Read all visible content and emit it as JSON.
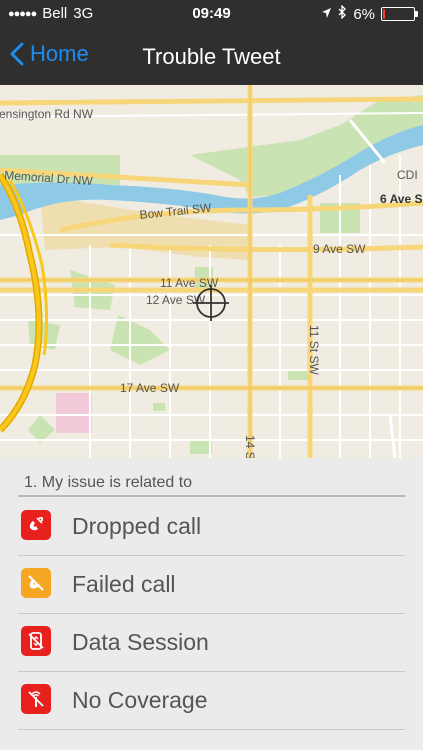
{
  "status_bar": {
    "signal": "●●●●●",
    "carrier": "Bell",
    "network": "3G",
    "time": "09:49",
    "battery_percent": "6%",
    "battery_level": 0.06
  },
  "nav": {
    "back_label": "Home",
    "title": "Trouble Tweet"
  },
  "map": {
    "labels": {
      "kensington": "ensington Rd NW",
      "memorial": "Memorial Dr NW",
      "bow_trail": "Bow Trail SW",
      "ave9": "9 Ave SW",
      "ave11": "11 Ave SW",
      "ave12": "12 Ave SW",
      "ave17": "17 Ave SW",
      "ave6": "6 Ave S",
      "st11": "11 St SW",
      "st14": "14 S",
      "cdi": "CDI"
    }
  },
  "form": {
    "section_title": "1. My issue is related to",
    "options": [
      {
        "label": "Dropped call",
        "icon": "dropped-call-icon",
        "color": "#e8201e"
      },
      {
        "label": "Failed call",
        "icon": "failed-call-icon",
        "color": "#f5a623"
      },
      {
        "label": "Data Session",
        "icon": "data-session-icon",
        "color": "#e8201e"
      },
      {
        "label": "No Coverage",
        "icon": "no-coverage-icon",
        "color": "#e8201e"
      }
    ]
  }
}
